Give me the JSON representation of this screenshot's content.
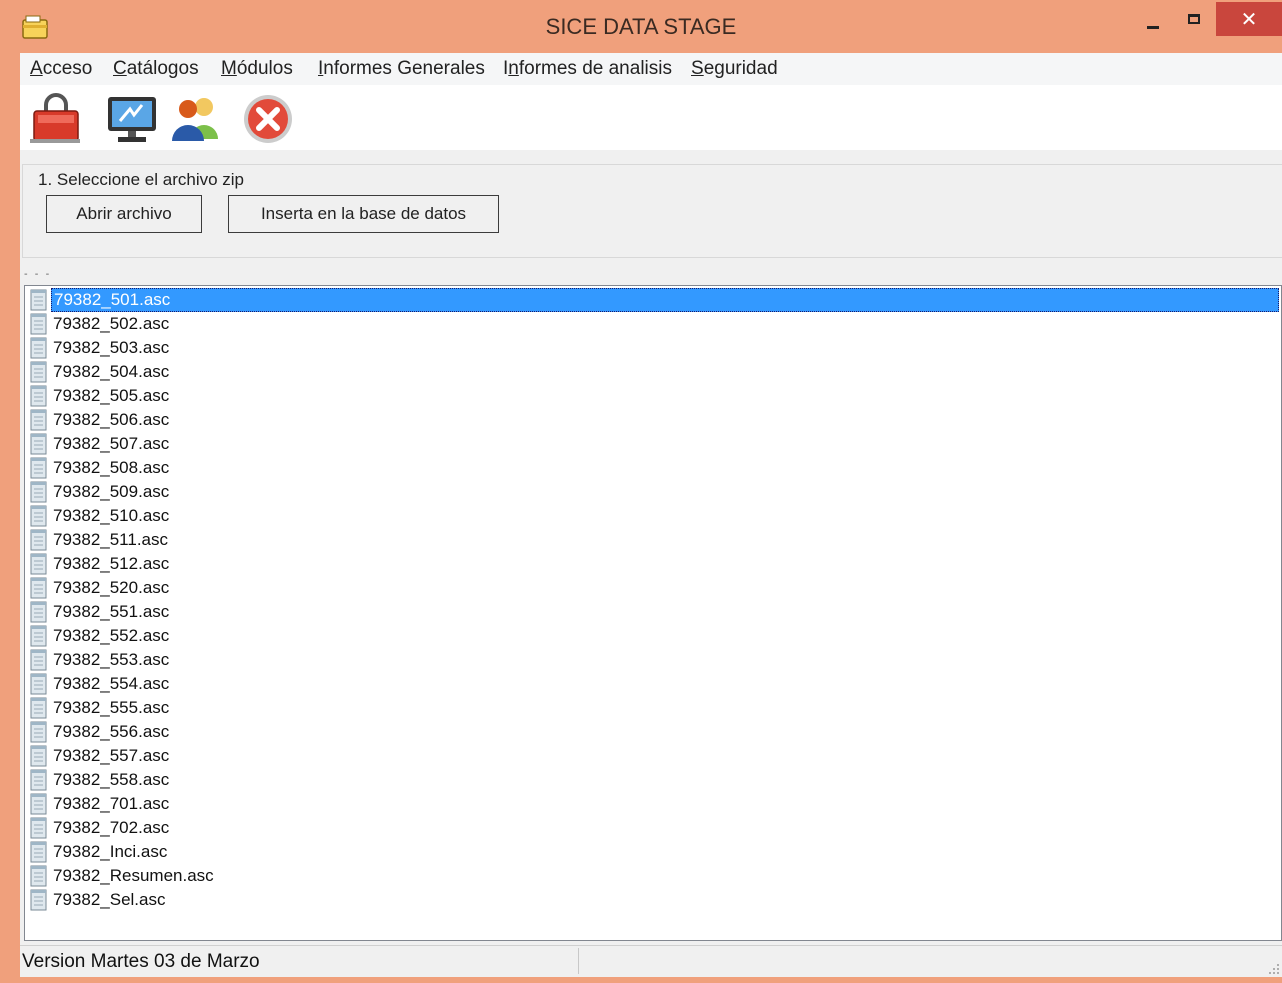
{
  "window": {
    "title": "SICE DATA STAGE",
    "close_glyph": "✕",
    "accent_color": "#f0a07c"
  },
  "menu": {
    "items": [
      {
        "key": "A",
        "rest": "cceso"
      },
      {
        "key": "C",
        "rest": "atálogos"
      },
      {
        "key": "M",
        "rest": "ódulos"
      },
      {
        "key": "I",
        "rest": "nformes Generales"
      },
      {
        "pre": "I",
        "key": "n",
        "rest": "formes de analisis"
      },
      {
        "key": "S",
        "rest": "eguridad"
      }
    ]
  },
  "toolbar": {
    "icons": [
      "lock-icon",
      "monitor-icon",
      "users-icon",
      "close-circle-icon"
    ]
  },
  "group": {
    "legend": "1. Seleccione el archivo zip",
    "open_button": "Abrir archivo",
    "insert_button": "Inserta en la base de datos"
  },
  "list_separator": "- - -",
  "files": [
    "79382_501.asc",
    "79382_502.asc",
    "79382_503.asc",
    "79382_504.asc",
    "79382_505.asc",
    "79382_506.asc",
    "79382_507.asc",
    "79382_508.asc",
    "79382_509.asc",
    "79382_510.asc",
    "79382_511.asc",
    "79382_512.asc",
    "79382_520.asc",
    "79382_551.asc",
    "79382_552.asc",
    "79382_553.asc",
    "79382_554.asc",
    "79382_555.asc",
    "79382_556.asc",
    "79382_557.asc",
    "79382_558.asc",
    "79382_701.asc",
    "79382_702.asc",
    "79382_Inci.asc",
    "79382_Resumen.asc",
    "79382_Sel.asc"
  ],
  "selected_file": "79382_501.asc",
  "status": {
    "text": "Version Martes 03 de Marzo"
  },
  "colors": {
    "selection": "#3399ff",
    "close_button": "#c9463d"
  }
}
